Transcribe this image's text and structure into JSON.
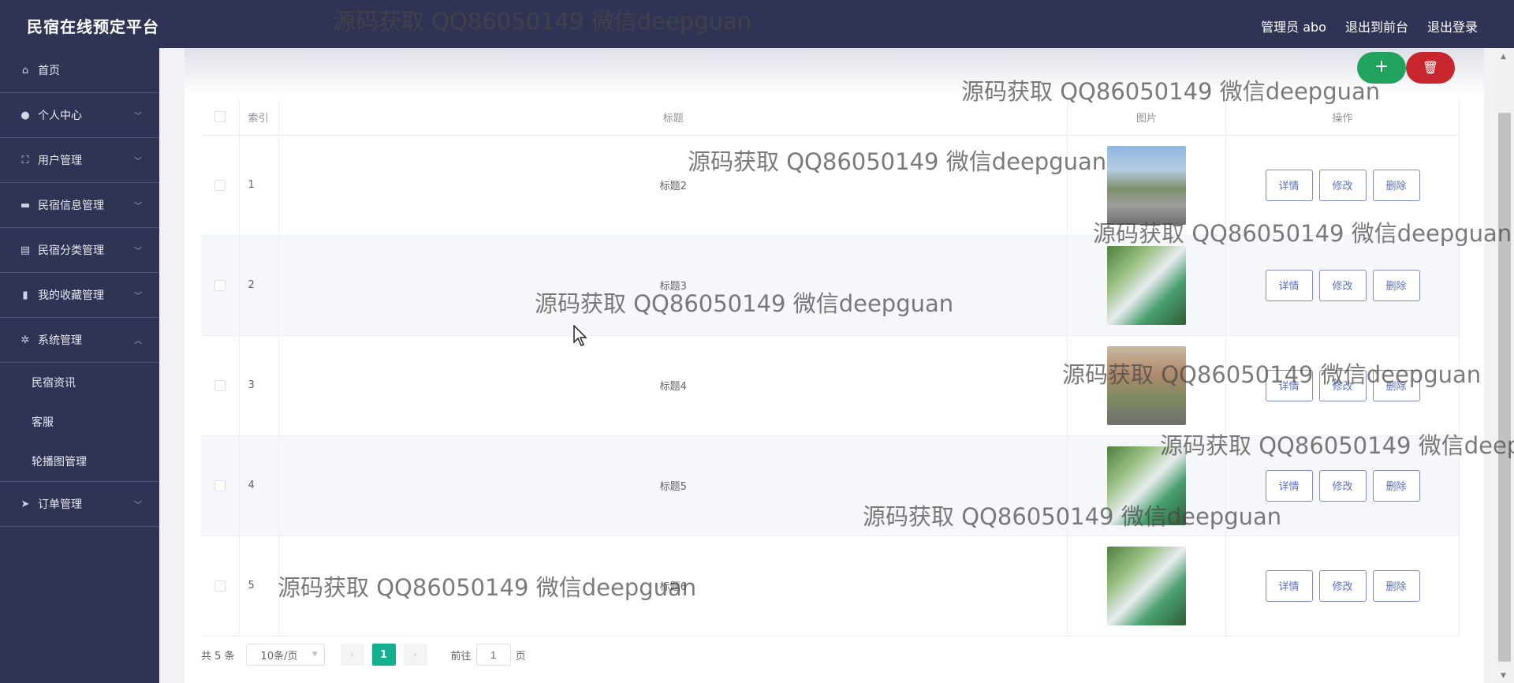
{
  "header": {
    "brand": "民宿在线预定平台",
    "admin": "管理员 abo",
    "front": "退出到前台",
    "logout": "退出登录"
  },
  "sidebar": {
    "items": [
      {
        "label": "首页",
        "icon": "home-icon"
      },
      {
        "label": "个人中心",
        "icon": "user-icon"
      },
      {
        "label": "用户管理",
        "icon": "users-frame-icon"
      },
      {
        "label": "民宿信息管理",
        "icon": "briefcase-icon"
      },
      {
        "label": "民宿分类管理",
        "icon": "clipboard-icon"
      },
      {
        "label": "我的收藏管理",
        "icon": "bar-chart-icon"
      },
      {
        "label": "系统管理",
        "icon": "cog-icon"
      },
      {
        "label": "订单管理",
        "icon": "paper-plane-icon"
      }
    ],
    "submenu": [
      "民宿资讯",
      "客服",
      "轮播图管理"
    ]
  },
  "toolbar": {
    "add": "+",
    "delete_icon": "trash-icon"
  },
  "table": {
    "headers": {
      "index": "索引",
      "title": "标题",
      "image": "图片",
      "ops": "操作"
    },
    "rows": [
      {
        "index": "1",
        "title": "标题2"
      },
      {
        "index": "2",
        "title": "标题3"
      },
      {
        "index": "3",
        "title": "标题4"
      },
      {
        "index": "4",
        "title": "标题5"
      },
      {
        "index": "5",
        "title": "标题6"
      }
    ],
    "actions": {
      "detail": "详情",
      "edit": "修改",
      "delete": "删除"
    }
  },
  "pager": {
    "total": "共 5 条",
    "size": "10条/页",
    "current": "1",
    "goto_label": "前往",
    "goto_value": "1",
    "page_suffix": "页"
  },
  "watermark": "源码获取 QQ86050149 微信deepguan",
  "colors": {
    "sidebar": "#2f3454",
    "accent": "#13b08e",
    "add": "#22a35d",
    "delete": "#c8262f"
  }
}
